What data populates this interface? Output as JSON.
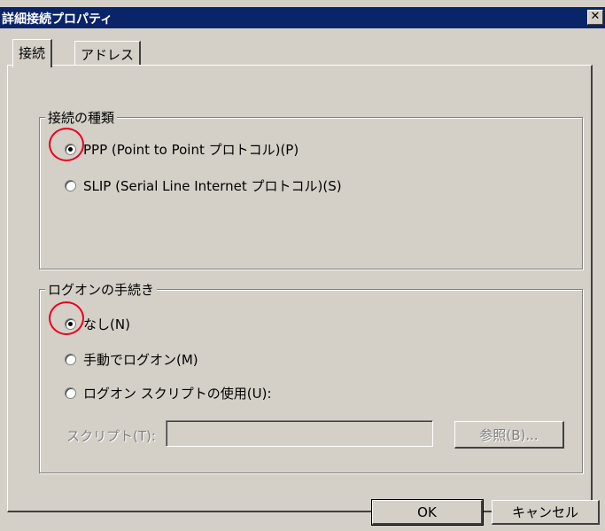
{
  "window": {
    "title": "詳細接続プロパティ",
    "close_glyph": "✕"
  },
  "tabs": [
    {
      "label": "接続",
      "active": true
    },
    {
      "label": "アドレス",
      "active": false
    }
  ],
  "connection_group": {
    "label": "接続の種類",
    "options": [
      {
        "label": "PPP (Point to Point プロトコル)(P)",
        "checked": true
      },
      {
        "label": "SLIP (Serial Line Internet プロトコル)(S)",
        "checked": false
      }
    ]
  },
  "logon_group": {
    "label": "ログオンの手続き",
    "options": [
      {
        "label": "なし(N)",
        "checked": true
      },
      {
        "label": "手動でログオン(M)",
        "checked": false
      },
      {
        "label": "ログオン スクリプトの使用(U):",
        "checked": false
      }
    ],
    "script_label": "スクリプト(T):",
    "script_value": "",
    "browse_label": "参照(B)..."
  },
  "buttons": {
    "ok": "OK",
    "cancel": "キャンセル"
  },
  "colors": {
    "titlebar": "#0a246a",
    "annotation": "#e8001c",
    "face": "#d4d0c8"
  }
}
